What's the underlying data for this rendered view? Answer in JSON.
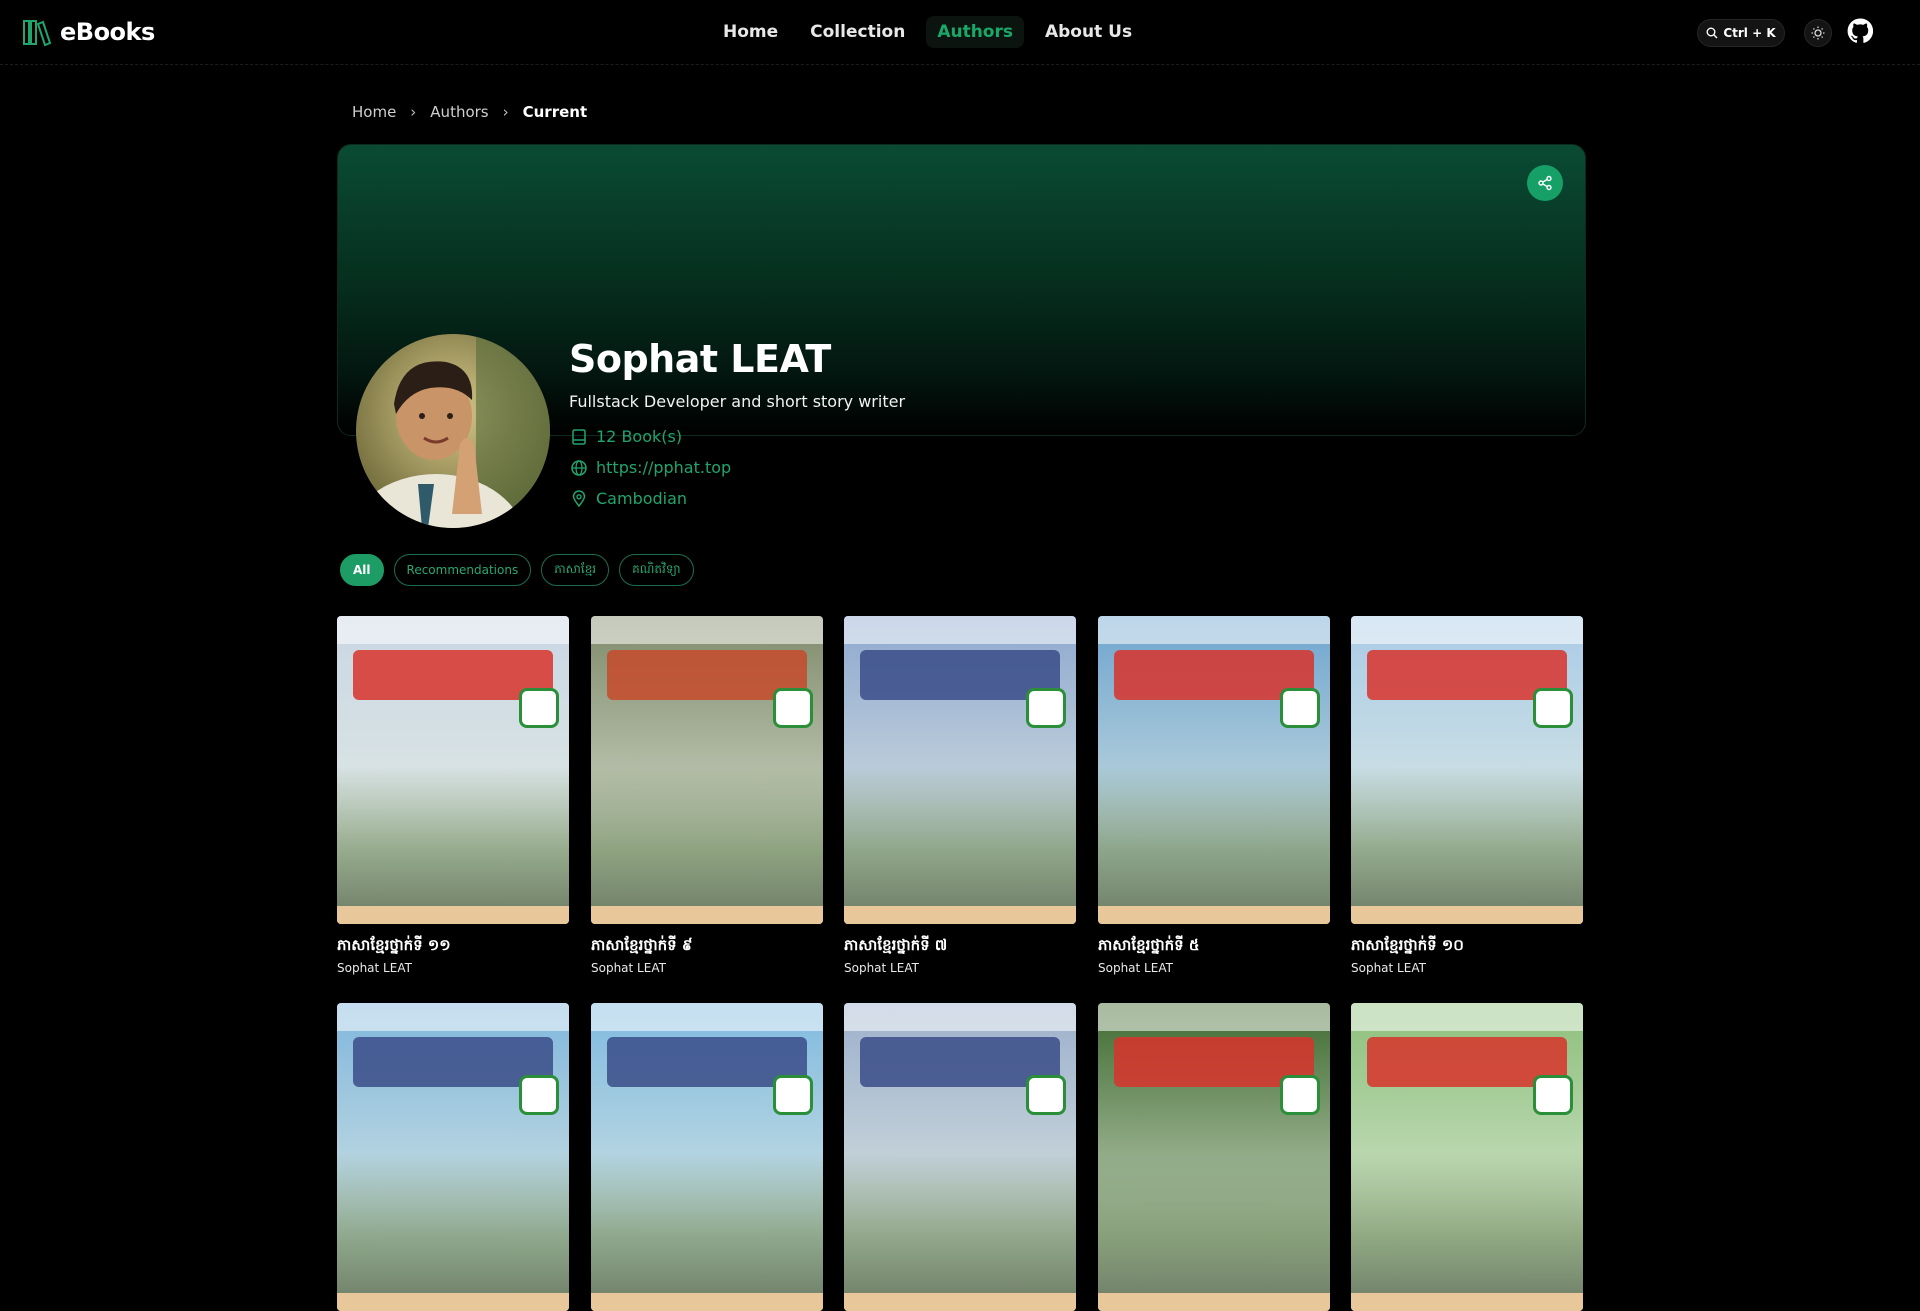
{
  "app": {
    "name": "eBooks"
  },
  "nav": {
    "items": [
      {
        "label": "Home",
        "active": false
      },
      {
        "label": "Collection",
        "active": false
      },
      {
        "label": "Authors",
        "active": true
      },
      {
        "label": "About Us",
        "active": false
      }
    ],
    "search_shortcut": "Ctrl + K"
  },
  "breadcrumb": {
    "items": [
      "Home",
      "Authors",
      "Current"
    ]
  },
  "author": {
    "name": "Sophat LEAT",
    "bio": "Fullstack Developer and short story writer",
    "books_count": "12 Book(s)",
    "website": "https://pphat.top",
    "nationality": "Cambodian"
  },
  "filters": [
    {
      "label": "All",
      "active": true
    },
    {
      "label": "Recommendations",
      "active": false
    },
    {
      "label": "ភាសាខ្មែរ",
      "active": false
    },
    {
      "label": "គណិតវិទ្យា",
      "active": false
    }
  ],
  "books": [
    {
      "title": "ភាសាខ្មែរថ្នាក់ទី ១១",
      "author": "Sophat LEAT",
      "cover_color": "#c9d6e4",
      "accent": "#d8322b"
    },
    {
      "title": "ភាសាខ្មែរថ្នាក់ទី ៩",
      "author": "Sophat LEAT",
      "cover_color": "#7f8a6a",
      "accent": "#c64a2a"
    },
    {
      "title": "ភាសាខ្មែរថ្នាក់ទី ៧",
      "author": "Sophat LEAT",
      "cover_color": "#8ea8cf",
      "accent": "#3a4c88"
    },
    {
      "title": "ភាសាខ្មែរថ្នាក់ទី ៥",
      "author": "Sophat LEAT",
      "cover_color": "#6ea4cf",
      "accent": "#d8322b"
    },
    {
      "title": "ភាសាខ្មែរថ្នាក់ទី ១០",
      "author": "Sophat LEAT",
      "cover_color": "#a9cbe6",
      "accent": "#d8322b"
    },
    {
      "title": "",
      "author": "",
      "cover_color": "#7fb6dc",
      "accent": "#3a4c88"
    },
    {
      "title": "",
      "author": "",
      "cover_color": "#7fb9df",
      "accent": "#3a4c88"
    },
    {
      "title": "",
      "author": "",
      "cover_color": "#9cb0cc",
      "accent": "#3a4c88"
    },
    {
      "title": "",
      "author": "",
      "cover_color": "#3f6a2f",
      "accent": "#d8322b"
    },
    {
      "title": "",
      "author": "",
      "cover_color": "#8cbf7a",
      "accent": "#d8322b"
    }
  ],
  "colors": {
    "accent": "#1e9c65",
    "background": "#000000"
  }
}
